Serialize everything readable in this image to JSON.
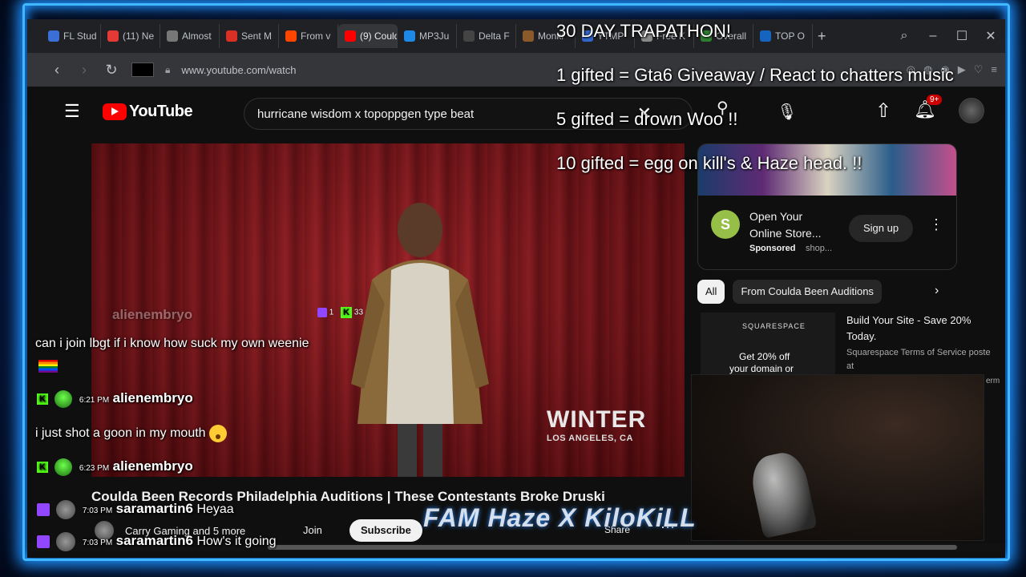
{
  "browser": {
    "tabs": [
      {
        "label": "FL Stud",
        "color": "#3b6fd6"
      },
      {
        "label": "(11) Ne",
        "color": "#e53935"
      },
      {
        "label": "Almost",
        "color": "#777777"
      },
      {
        "label": "Sent M",
        "color": "#d93025"
      },
      {
        "label": "From v",
        "color": "#ff4500"
      },
      {
        "label": "(9) Could",
        "color": "#ff0000"
      },
      {
        "label": "MP3Ju",
        "color": "#1e88e5"
      },
      {
        "label": "Delta F",
        "color": "#444444"
      },
      {
        "label": "Monki",
        "color": "#8b5a2b"
      },
      {
        "label": "YTMP",
        "color": "#3366cc"
      },
      {
        "label": "Free K",
        "color": "#888888"
      },
      {
        "label": "Overall",
        "color": "#2e7d32"
      },
      {
        "label": "TOP O",
        "color": "#1565c0"
      }
    ],
    "url": "www.youtube.com/watch"
  },
  "youtube": {
    "logo_text": "YouTube",
    "search_query": "hurricane wisdom x topoppgen type beat",
    "notification_count": "9+",
    "video": {
      "overlay_name": "WINTER",
      "overlay_location": "LOS ANGELES, CA",
      "title": "Coulda Been Records Philadelphia Auditions | These Contestants Broke Druski",
      "channel_row": "Carry Gaming and 5 more",
      "join": "Join",
      "subscribe": "Subscribe",
      "share": "Share"
    },
    "ad": {
      "title": "Open Your Online Store...",
      "sponsored": "Sponsored",
      "domain": "shop...",
      "cta": "Sign up"
    },
    "chips": [
      "All",
      "From Coulda Been Auditions"
    ],
    "rec": {
      "thumb_logo": "SQUARESPACE",
      "thumb_line1": "Get 20% off",
      "thumb_line2": "your domain or",
      "title": "Build Your Site - Save 20% Today.",
      "sub": "Squarespace Terms of Service poste at",
      "term": "erm"
    }
  },
  "stream": {
    "goals": [
      "30 DAY TRAPATHON!",
      "1 gifted = Gta6 Giveaway / React to chatters music",
      "5 gifted = drown Woo  !!",
      "10 gifted = egg on kill's & Haze head. !!"
    ],
    "viewer_counts": {
      "twitch": "1",
      "kick": "33"
    },
    "chat": [
      {
        "time": "",
        "user": "alienembryo",
        "message": "can i join lbgt if i know how suck my own weenie"
      },
      {
        "time": "6:21 PM",
        "user": "alienembryo",
        "message": "i just shot a goon in my mouth"
      },
      {
        "time": "6:23 PM",
        "user": "alienembryo",
        "message": ""
      },
      {
        "time": "7:03 PM",
        "user": "saramartin6",
        "message": "Heyaa"
      },
      {
        "time": "7:03 PM",
        "user": "saramartin6",
        "message": "How's it going"
      }
    ],
    "watermark": "FAM Haze X KiloKiLL"
  }
}
